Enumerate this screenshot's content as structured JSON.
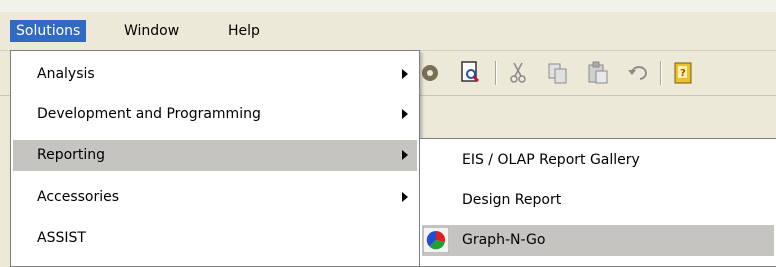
{
  "menubar": {
    "items": [
      {
        "label": "Solutions"
      },
      {
        "label": "Window"
      },
      {
        "label": "Help"
      }
    ]
  },
  "toolbar": {
    "icons": [
      "tool-icon",
      "print-preview-icon",
      "cut-icon",
      "copy-icon",
      "paste-icon",
      "undo-icon",
      "help-book-icon"
    ]
  },
  "solutions_menu": {
    "items": [
      {
        "label": "Analysis",
        "has_submenu": true
      },
      {
        "label": "Development and Programming",
        "has_submenu": true
      },
      {
        "label": "Reporting",
        "has_submenu": true,
        "highlighted": true
      },
      {
        "label": "Accessories",
        "has_submenu": true
      },
      {
        "label": "ASSIST",
        "has_submenu": false
      }
    ]
  },
  "reporting_submenu": {
    "items": [
      {
        "label": "EIS / OLAP Report Gallery"
      },
      {
        "label": "Design Report"
      },
      {
        "label": "Graph-N-Go",
        "highlighted": true,
        "icon": "graph-n-go-icon"
      }
    ]
  },
  "colors": {
    "menubar_selected": "#316ac5",
    "menu_highlight": "#c5c4c0",
    "menu_background": "#ffffff",
    "chrome_background": "#ece9d8"
  }
}
